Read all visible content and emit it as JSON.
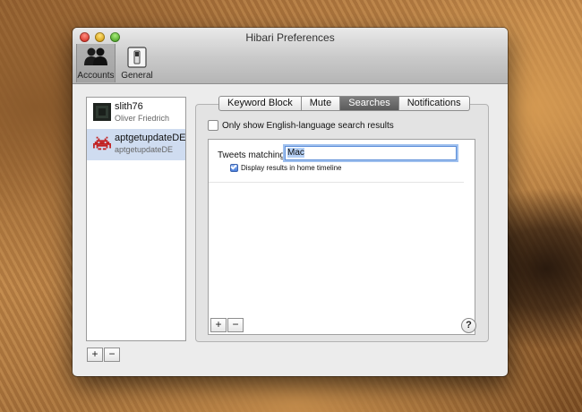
{
  "window": {
    "title": "Hibari Preferences"
  },
  "toolbar": {
    "accounts_label": "Accounts",
    "general_label": "General"
  },
  "accounts": [
    {
      "name": "slith76",
      "subtitle": "Oliver Friedrich"
    },
    {
      "name": "aptgetupdateDE",
      "subtitle": "aptgetupdateDE"
    }
  ],
  "account_buttons": {
    "add": "+",
    "remove": "−"
  },
  "tabs": [
    {
      "label": "Keyword Block"
    },
    {
      "label": "Mute"
    },
    {
      "label": "Searches"
    },
    {
      "label": "Notifications"
    }
  ],
  "selected_tab": "Searches",
  "searches": {
    "english_only_label": "Only show English-language search results",
    "english_only_checked": false,
    "tweets_matching_label": "Tweets matching",
    "tweets_matching_value": "Mac",
    "display_in_home_label": "Display results in home timeline",
    "display_in_home_checked": true,
    "add": "+",
    "remove": "−",
    "help": "?"
  }
}
